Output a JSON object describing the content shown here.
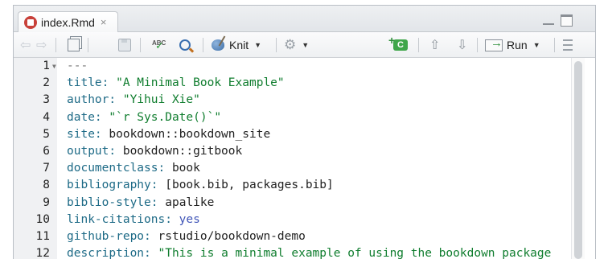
{
  "tab": {
    "filename": "index.Rmd",
    "close_glyph": "×"
  },
  "toolbar": {
    "back_glyph": "⇦",
    "forward_glyph": "⇨",
    "spell_abc": "ABC",
    "knit_label": "Knit",
    "knit_caret": "▼",
    "settings_caret": "▼",
    "add_chunk_label": "C",
    "up_glyph": "⇧",
    "down_glyph": "⇩",
    "run_label": "Run",
    "run_caret": "▼"
  },
  "editor": {
    "lines": [
      {
        "n": "1",
        "fold": "▼",
        "key": "",
        "value": "---",
        "value_style": "dashes"
      },
      {
        "n": "2",
        "key": "title:",
        "value": " \"A Minimal Book Example\"",
        "value_style": "str"
      },
      {
        "n": "3",
        "key": "author:",
        "value": " \"Yihui Xie\"",
        "value_style": "str"
      },
      {
        "n": "4",
        "key": "date:",
        "value": " \"`r Sys.Date()`\"",
        "value_style": "str"
      },
      {
        "n": "5",
        "key": "site:",
        "value": " bookdown::bookdown_site",
        "value_style": "plain"
      },
      {
        "n": "6",
        "key": "output:",
        "value": " bookdown::gitbook",
        "value_style": "plain"
      },
      {
        "n": "7",
        "key": "documentclass:",
        "value": " book",
        "value_style": "plain"
      },
      {
        "n": "8",
        "key": "bibliography:",
        "value": " [book.bib, packages.bib]",
        "value_style": "plain"
      },
      {
        "n": "9",
        "key": "biblio-style:",
        "value": " apalike",
        "value_style": "plain"
      },
      {
        "n": "10",
        "key": "link-citations:",
        "value": " yes",
        "value_style": "kw"
      },
      {
        "n": "11",
        "key": "github-repo:",
        "value": " rstudio/bookdown-demo",
        "value_style": "plain"
      },
      {
        "n": "12",
        "key": "description:",
        "value": " \"This is a minimal example of using the bookdown package",
        "value_style": "str"
      }
    ]
  },
  "colors": {
    "yaml_key": "#1d6a86",
    "string": "#0f7d2e",
    "keyword": "#4055b8",
    "text": "#222222",
    "gutter_bg": "#f0f1f3",
    "rmd_icon": "#c8413a"
  }
}
